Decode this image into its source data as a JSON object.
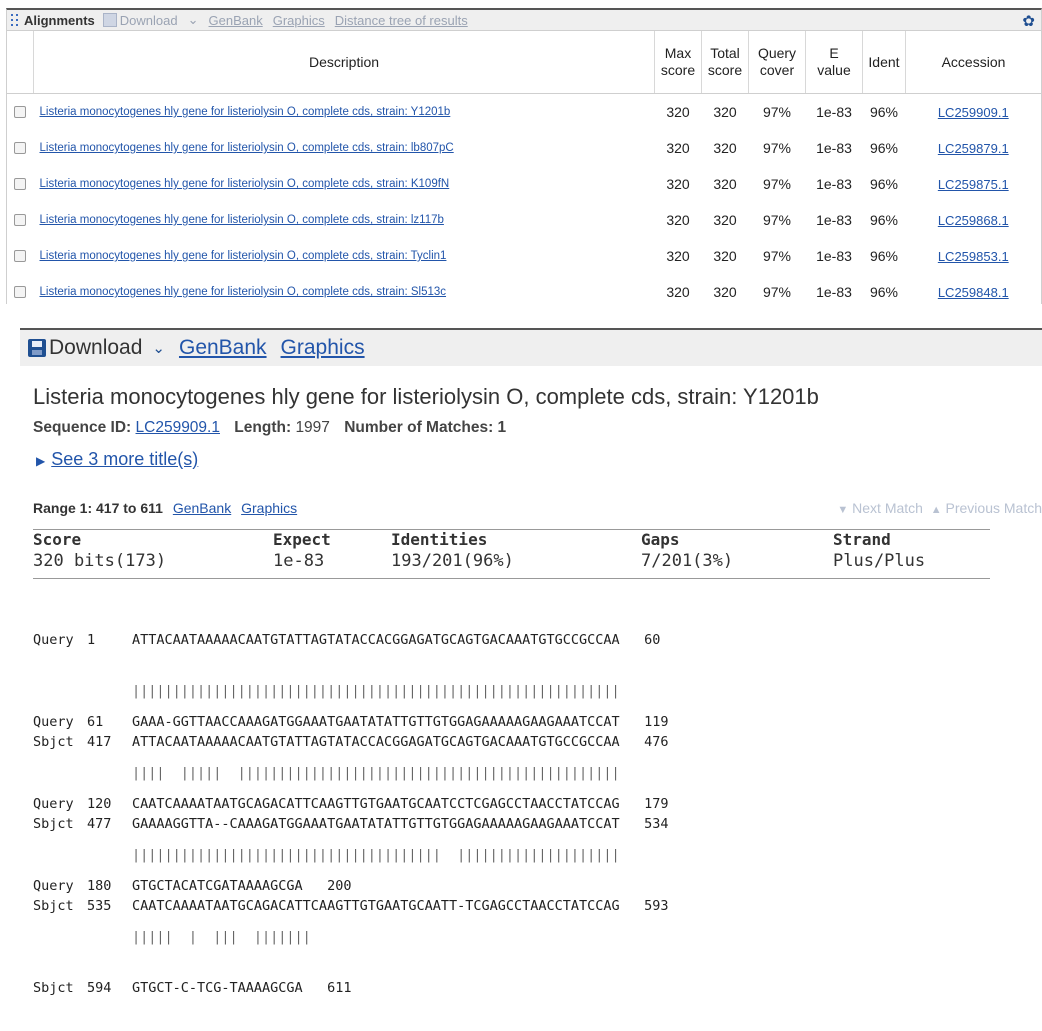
{
  "toolbar": {
    "alignments": "Alignments",
    "download": "Download",
    "download_chevron": "⌄",
    "genbank": "GenBank",
    "graphics": "Graphics",
    "distance_tree": "Distance tree of results"
  },
  "table": {
    "headers": {
      "description": "Description",
      "max_score": "Max\nscore",
      "total_score": "Total\nscore",
      "query_cover": "Query\ncover",
      "e_value": "E\nvalue",
      "ident": "Ident",
      "accession": "Accession"
    },
    "rows": [
      {
        "description": "Listeria monocytogenes hly gene for listeriolysin O, complete cds, strain: Y1201b",
        "max_score": "320",
        "total_score": "320",
        "query_cover": "97%",
        "e_value": "1e-83",
        "ident": "96%",
        "accession": "LC259909.1"
      },
      {
        "description": "Listeria monocytogenes hly gene for listeriolysin O, complete cds, strain: lb807pC",
        "max_score": "320",
        "total_score": "320",
        "query_cover": "97%",
        "e_value": "1e-83",
        "ident": "96%",
        "accession": "LC259879.1"
      },
      {
        "description": "Listeria monocytogenes hly gene for listeriolysin O, complete cds, strain: K109fN",
        "max_score": "320",
        "total_score": "320",
        "query_cover": "97%",
        "e_value": "1e-83",
        "ident": "96%",
        "accession": "LC259875.1"
      },
      {
        "description": "Listeria monocytogenes hly gene for listeriolysin O, complete cds, strain: lz117b",
        "max_score": "320",
        "total_score": "320",
        "query_cover": "97%",
        "e_value": "1e-83",
        "ident": "96%",
        "accession": "LC259868.1"
      },
      {
        "description": "Listeria monocytogenes hly gene for listeriolysin O, complete cds, strain: Tyclin1",
        "max_score": "320",
        "total_score": "320",
        "query_cover": "97%",
        "e_value": "1e-83",
        "ident": "96%",
        "accession": "LC259853.1"
      },
      {
        "description": "Listeria monocytogenes hly gene for listeriolysin O, complete cds, strain: Sl513c",
        "max_score": "320",
        "total_score": "320",
        "query_cover": "97%",
        "e_value": "1e-83",
        "ident": "96%",
        "accession": "LC259848.1"
      }
    ]
  },
  "detail": {
    "download": "Download",
    "download_chevron": "⌄",
    "genbank": "GenBank",
    "graphics": "Graphics",
    "title": "Listeria monocytogenes hly gene for listeriolysin O, complete cds, strain: Y1201b",
    "seq_id_label": "Sequence ID:",
    "seq_id": "LC259909.1",
    "length_label": "Length:",
    "length": "1997",
    "matches_label": "Number of Matches:",
    "matches": "1",
    "see_more": "See 3 more title(s)",
    "range_label": "Range 1: 417 to 611",
    "range_genbank": "GenBank",
    "range_graphics": "Graphics",
    "next_match": "Next Match",
    "previous_match": "Previous Match",
    "stats": {
      "score_h": "Score",
      "score_v": "320 bits(173)",
      "expect_h": "Expect",
      "expect_v": "1e-83",
      "identities_h": "Identities",
      "identities_v": "193/201(96%)",
      "gaps_h": "Gaps",
      "gaps_v": "7/201(3%)",
      "strand_h": "Strand",
      "strand_v": "Plus/Plus"
    },
    "alignment": [
      {
        "q_label": "Query",
        "q_start": "1",
        "q_seq": "ATTACAATAAAAACAATGTATTAGTATACCACGGAGATGCAGTGACAAATGTGCCGCCAA",
        "q_end": "60",
        "mid": "||||||||||||||||||||||||||||||||||||||||||||||||||||||||||||",
        "s_label": "Sbjct",
        "s_start": "417",
        "s_seq": "ATTACAATAAAAACAATGTATTAGTATACCACGGAGATGCAGTGACAAATGTGCCGCCAA",
        "s_end": "476"
      },
      {
        "q_label": "Query",
        "q_start": "61",
        "q_seq": "GAAA-GGTTAACCAAAGATGGAAATGAATATATTGTTGTGGAGAAAAAGAAGAAATCCAT",
        "q_end": "119",
        "mid": "||||  |||||  |||||||||||||||||||||||||||||||||||||||||||||||",
        "s_label": "Sbjct",
        "s_start": "477",
        "s_seq": "GAAAAGGTTA--CAAAGATGGAAATGAATATATTGTTGTGGAGAAAAAGAAGAAATCCAT",
        "s_end": "534"
      },
      {
        "q_label": "Query",
        "q_start": "120",
        "q_seq": "CAATCAAAATAATGCAGACATTCAAGTTGTGAATGCAATCCTCGAGCCTAACCTATCCAG",
        "q_end": "179",
        "mid": "||||||||||||||||||||||||||||||||||||||  ||||||||||||||||||||",
        "s_label": "Sbjct",
        "s_start": "535",
        "s_seq": "CAATCAAAATAATGCAGACATTCAAGTTGTGAATGCAATT-TCGAGCCTAACCTATCCAG",
        "s_end": "593"
      },
      {
        "q_label": "Query",
        "q_start": "180",
        "q_seq": "GTGCTACATCGATAAAAGCGA",
        "q_end": "200",
        "mid": "|||||  |  |||  |||||||",
        "s_label": "Sbjct",
        "s_start": "594",
        "s_seq": "GTGCT-C-TCG-TAAAAGCGA",
        "s_end": "611"
      }
    ]
  }
}
